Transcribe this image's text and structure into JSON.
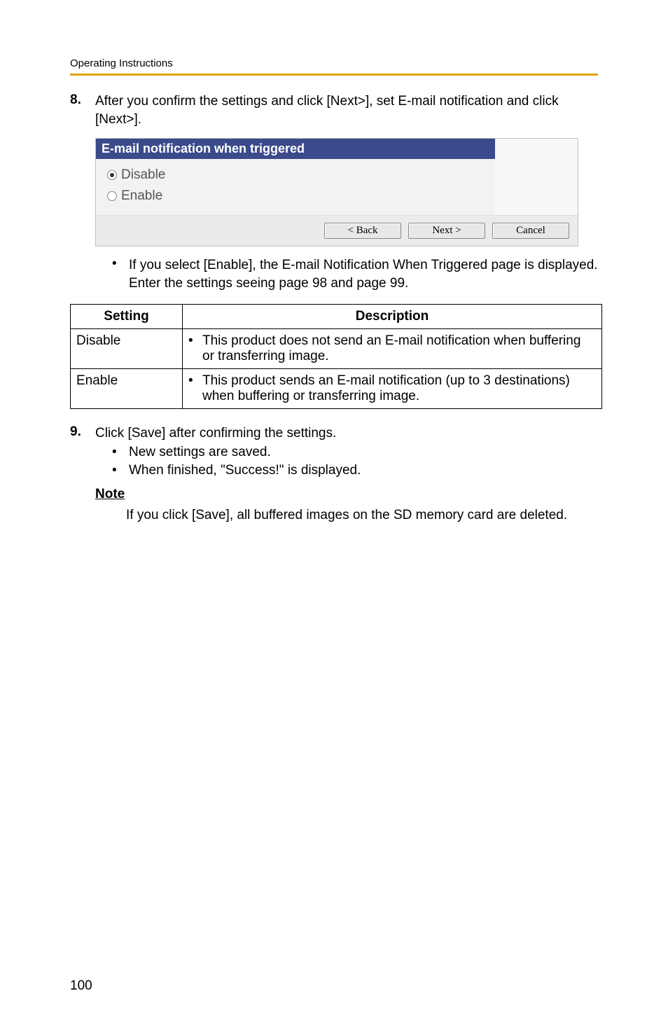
{
  "header": {
    "title": "Operating Instructions"
  },
  "step8": {
    "number": "8.",
    "text": "After you confirm the settings and click [Next>], set E-mail notification and click [Next>]."
  },
  "panel": {
    "title": "E-mail notification when triggered",
    "opt_disable": "Disable",
    "opt_enable": "Enable",
    "btn_back": "< Back",
    "btn_next": "Next >",
    "btn_cancel": "Cancel"
  },
  "sub_bullet_8": "If you select [Enable], the E-mail Notification When Triggered page is displayed. Enter the settings seeing page 98 and page 99.",
  "table": {
    "head_setting": "Setting",
    "head_description": "Description",
    "row1_setting": "Disable",
    "row1_desc": "This product does not send an E-mail notification when buffering or transferring image.",
    "row2_setting": "Enable",
    "row2_desc": "This product sends an E-mail notification (up to 3 destinations) when buffering or transferring image."
  },
  "step9": {
    "number": "9.",
    "text": "Click [Save] after confirming the settings.",
    "bullet1": "New settings are saved.",
    "bullet2": "When finished, \"Success!\" is displayed."
  },
  "note": {
    "heading": "Note",
    "body": "If you click [Save], all buffered images on the SD memory card are deleted."
  },
  "page_number": "100"
}
